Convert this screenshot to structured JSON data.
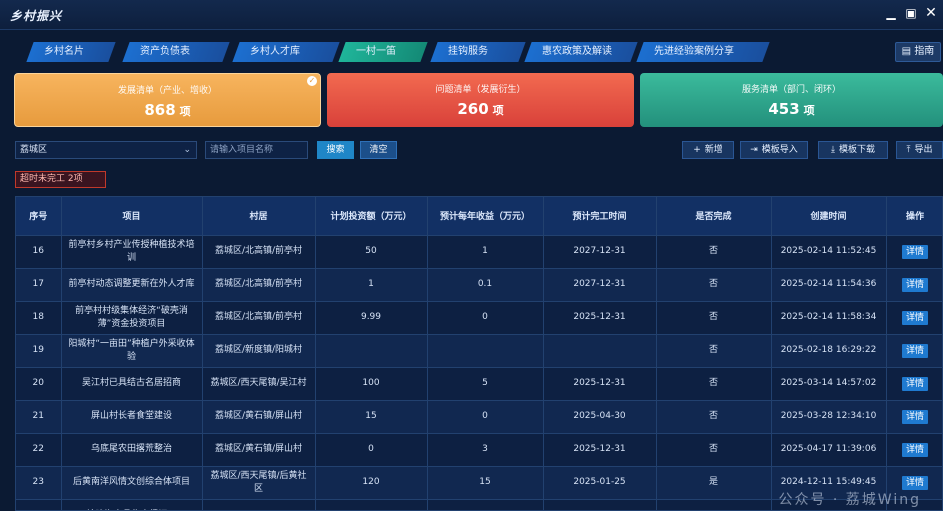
{
  "app": {
    "title": "乡村振兴"
  },
  "window": {
    "min": "▁",
    "max": "▣",
    "close": "✕"
  },
  "tabs": [
    {
      "label": "乡村名片",
      "active": false
    },
    {
      "label": "资产负债表",
      "active": false
    },
    {
      "label": "乡村人才库",
      "active": false
    },
    {
      "label": "一村一笛",
      "active": true
    },
    {
      "label": "挂钩服务",
      "active": false
    },
    {
      "label": "惠农政策及解读",
      "active": false
    },
    {
      "label": "先进经验案例分享",
      "active": false
    }
  ],
  "guide": {
    "label": "指南",
    "icon": "document-icon"
  },
  "cards": {
    "development": {
      "title": "发展清单（产业、增收）",
      "count": "868",
      "unit": "项",
      "color": "#e79b3d"
    },
    "problem": {
      "title": "问题清单（发展衍生）",
      "count": "260",
      "unit": "项",
      "color": "#d9413a"
    },
    "service": {
      "title": "服务清单（部门、闭环）",
      "count": "453",
      "unit": "项",
      "color": "#23907c"
    }
  },
  "filters": {
    "district": "荔城区",
    "search_placeholder": "请输入项目名称",
    "search_label": "搜索",
    "clear_label": "清空"
  },
  "toolbar": {
    "add": "新增",
    "import": "模板导入",
    "download": "模板下载",
    "export": "导出"
  },
  "overdue_badge": "超时未完工 2项",
  "table": {
    "headers": [
      "序号",
      "项目",
      "村居",
      "计划投资额（万元）",
      "预计每年收益（万元）",
      "预计完工时间",
      "是否完成",
      "创建时间",
      "操作"
    ],
    "detail_label": "详情",
    "rows": [
      [
        "16",
        "前亭村乡村产业传授种植技术培训",
        "荔城区/北高镇/前亭村",
        "50",
        "1",
        "2027-12-31",
        "否",
        "2025-02-14 11:52:45"
      ],
      [
        "17",
        "前亭村动态调整更新在外人才库",
        "荔城区/北高镇/前亭村",
        "1",
        "0.1",
        "2027-12-31",
        "否",
        "2025-02-14 11:54:36"
      ],
      [
        "18",
        "前亭村村级集体经济“破壳消薄”资金投资项目",
        "荔城区/北高镇/前亭村",
        "9.99",
        "0",
        "2025-12-31",
        "否",
        "2025-02-14 11:58:34"
      ],
      [
        "19",
        "阳城村“一亩田”种植户外采收体验",
        "荔城区/新度镇/阳城村",
        "",
        "",
        "",
        "否",
        "2025-02-18 16:29:22"
      ],
      [
        "20",
        "吴江村已具结古名居招商",
        "荔城区/西天尾镇/吴江村",
        "100",
        "5",
        "2025-12-31",
        "否",
        "2025-03-14 14:57:02"
      ],
      [
        "21",
        "屏山村长者食堂建设",
        "荔城区/黄石镇/屏山村",
        "15",
        "0",
        "2025-04-30",
        "否",
        "2025-03-28 12:34:10"
      ],
      [
        "22",
        "乌底尾农田撂荒整治",
        "荔城区/黄石镇/屏山村",
        "0",
        "3",
        "2025-12-31",
        "否",
        "2025-04-17 11:39:06"
      ],
      [
        "23",
        "后黄南洋风情文创综合体项目",
        "荔城区/西天尾镇/后黄社区",
        "120",
        "15",
        "2025-01-25",
        "是",
        "2024-12-11 15:49:45"
      ],
      [
        "24",
        "塘建海产品集直播间…",
        "",
        "",
        "",
        "",
        "",
        ""
      ]
    ]
  },
  "watermark": "公众号 · 荔城Wing"
}
